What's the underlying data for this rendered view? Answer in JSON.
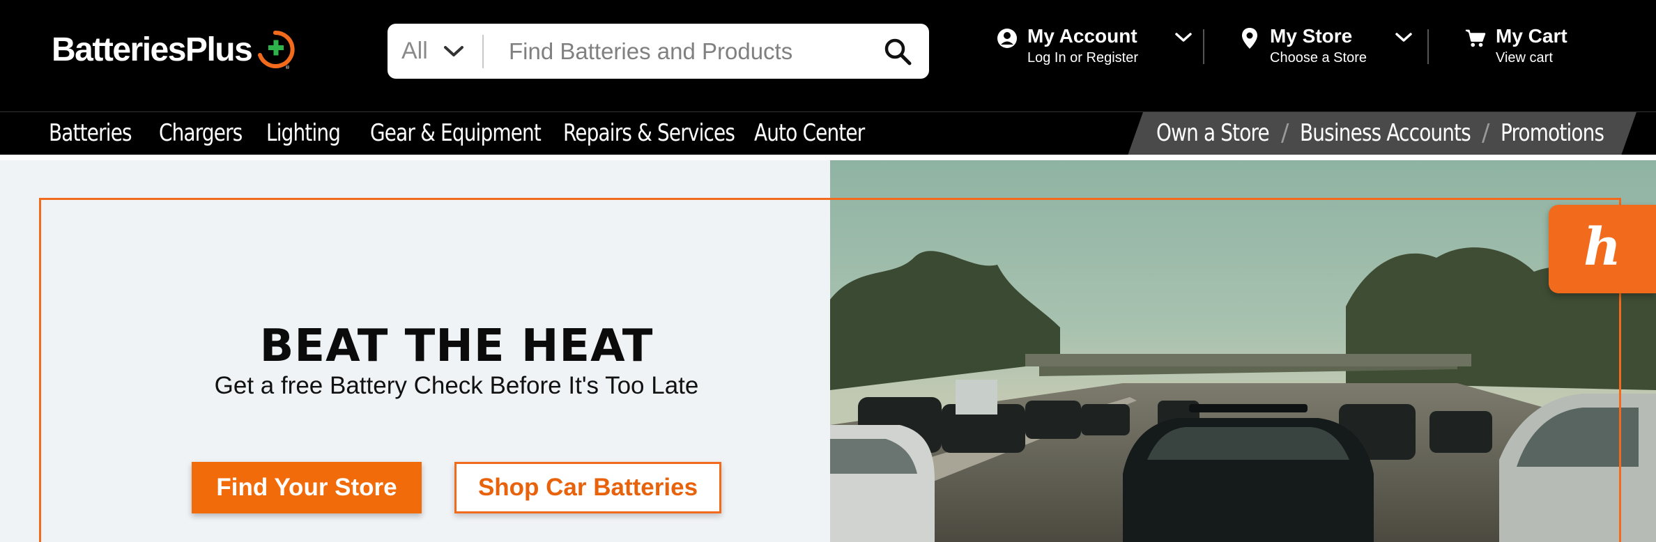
{
  "header": {
    "logo": {
      "text": "BatteriesPlus",
      "brand_orange": "#f26b1d",
      "brand_green": "#2db34a"
    },
    "search": {
      "category_label": "All",
      "placeholder": "Find Batteries and Products",
      "icon": "search-icon"
    },
    "account": {
      "title": "My Account",
      "subtitle": "Log In or Register",
      "icon": "user-circle-icon"
    },
    "store": {
      "title": "My Store",
      "subtitle": "Choose a Store",
      "icon": "location-pin-icon"
    },
    "cart": {
      "title": "My Cart",
      "subtitle": "View cart",
      "icon": "cart-icon"
    }
  },
  "nav": {
    "items": [
      {
        "label": "Batteries"
      },
      {
        "label": "Chargers"
      },
      {
        "label": "Lighting"
      },
      {
        "label": "Gear & Equipment"
      },
      {
        "label": "Repairs & Services"
      },
      {
        "label": "Auto Center"
      }
    ],
    "secondary": [
      {
        "label": "Own a Store"
      },
      {
        "label": "Business Accounts"
      },
      {
        "label": "Promotions"
      }
    ],
    "separator": "/"
  },
  "hero": {
    "title": "BEAT THE HEAT",
    "subtitle": "Get a free Battery Check Before It's Too Late",
    "primary_button": "Find Your Store",
    "secondary_button": "Shop Car Batteries",
    "accent": "#f26b1d"
  },
  "honey": {
    "glyph": "h",
    "icon": "honey-extension-icon"
  }
}
